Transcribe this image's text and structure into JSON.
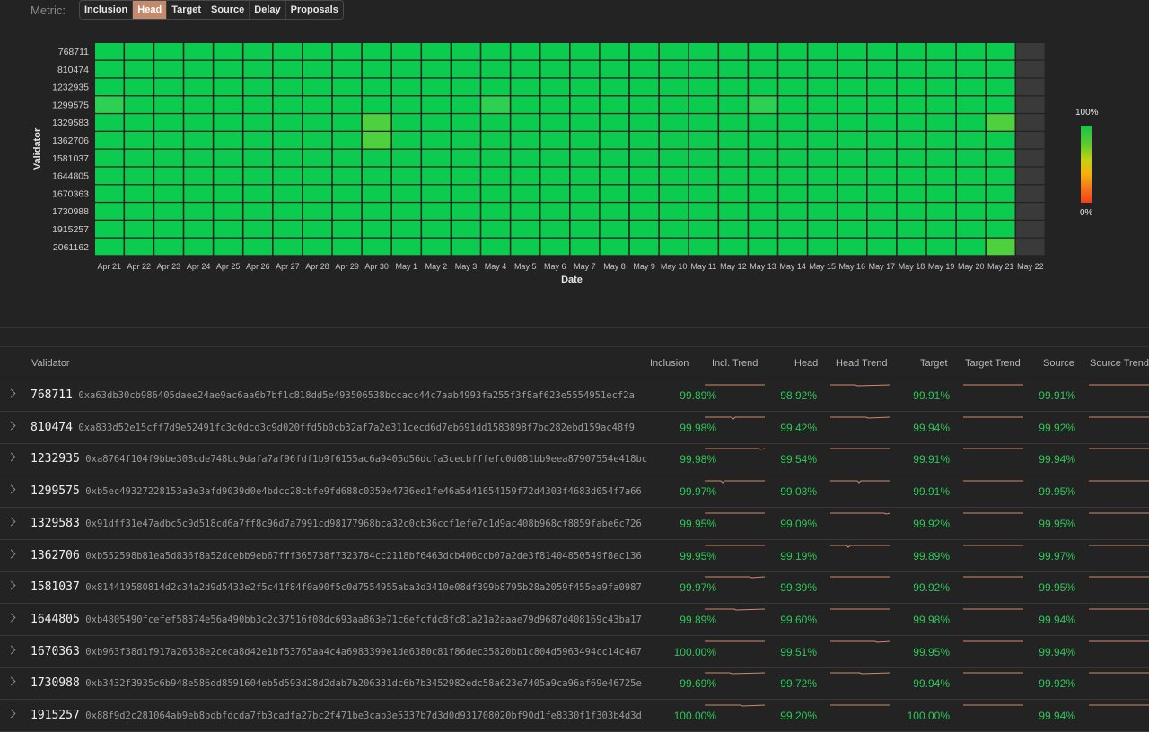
{
  "metric": {
    "label": "Metric:",
    "options": [
      "Inclusion",
      "Head",
      "Target",
      "Source",
      "Delay",
      "Proposals"
    ],
    "active": "Head"
  },
  "heatmap": {
    "ylabel": "Validator",
    "xlabel": "Date",
    "validators": [
      "768711",
      "810474",
      "1232935",
      "1299575",
      "1329583",
      "1362706",
      "1581037",
      "1644805",
      "1670363",
      "1730988",
      "1915257",
      "2061162"
    ],
    "dates": [
      "Apr 21",
      "Apr 22",
      "Apr 23",
      "Apr 24",
      "Apr 25",
      "Apr 26",
      "Apr 27",
      "Apr 28",
      "Apr 29",
      "Apr 30",
      "May 1",
      "May 2",
      "May 3",
      "May 4",
      "May 5",
      "May 6",
      "May 7",
      "May 8",
      "May 9",
      "May 10",
      "May 11",
      "May 12",
      "May 13",
      "May 14",
      "May 15",
      "May 16",
      "May 17",
      "May 18",
      "May 19",
      "May 20",
      "May 21",
      "May 22"
    ],
    "highlights": [
      {
        "validator": "1299575",
        "date": "Apr 21",
        "level": "light"
      },
      {
        "validator": "1299575",
        "date": "May 4",
        "level": "light"
      },
      {
        "validator": "1299575",
        "date": "May 13",
        "level": "light"
      },
      {
        "validator": "1329583",
        "date": "Apr 30",
        "level": "medium"
      },
      {
        "validator": "1329583",
        "date": "May 21",
        "level": "medium"
      },
      {
        "validator": "1362706",
        "date": "Apr 30",
        "level": "medium"
      },
      {
        "validator": "2061162",
        "date": "May 21",
        "level": "medium"
      }
    ],
    "no_data_date": "May 22",
    "legend": {
      "top": "100%",
      "bottom": "0%"
    },
    "colors": {
      "full": "#0ccc4f",
      "light": "#2dd052",
      "medium": "#4fd13f",
      "nodata": "#3a3a3a"
    }
  },
  "table": {
    "headers": [
      "Validator",
      "Inclusion",
      "Incl. Trend",
      "Head",
      "Head Trend",
      "Target",
      "Target Trend",
      "Source",
      "Source Trend"
    ],
    "rows": [
      {
        "id": "768711",
        "address": "0xa63db30cb986405daee24ae9ac6aa6b7bf1c818dd5e493506538bccacc44c7aab4993fa255f3f8af623e5554951ecf2a",
        "inclusion": "99.89%",
        "head": "98.92%",
        "target": "99.91%",
        "source": "99.91%"
      },
      {
        "id": "810474",
        "address": "0xa833d52e15cff7d9e52491fc3c0dcd3c9d020ffd5b0cb32af7a2e311cecd6d7eb691dd1583898f7bd282ebd159ac48f9",
        "inclusion": "99.98%",
        "head": "99.42%",
        "target": "99.94%",
        "source": "99.92%"
      },
      {
        "id": "1232935",
        "address": "0xa8764f104f9bbe308cde748bc9dafa7af96fdf1b9f6155ac6a9405d56dcfa3cecbfffefc0d081bb9eea87907554e418bc",
        "inclusion": "99.98%",
        "head": "99.54%",
        "target": "99.91%",
        "source": "99.94%"
      },
      {
        "id": "1299575",
        "address": "0xb5ec49327228153a3e3afd9039d0e4bdcc28cbfe9fd688c0359e4736ed1fe46a5d41654159f72d4303f4683d054f7a66",
        "inclusion": "99.97%",
        "head": "99.03%",
        "target": "99.91%",
        "source": "99.95%"
      },
      {
        "id": "1329583",
        "address": "0x91dff31e47adbc5c9d518cd6a7ff8c96d7a7991cd98177968bca32c0cb36ccf1efe7d1d9ac408b968cf8859fabe6c726",
        "inclusion": "99.95%",
        "head": "99.09%",
        "target": "99.92%",
        "source": "99.95%"
      },
      {
        "id": "1362706",
        "address": "0xb552598b81ea5d836f8a52dcebb9eb67fff365738f7323784cc2118bf6463dcb406ccb07a2de3f81404850549f8ec136",
        "inclusion": "99.95%",
        "head": "99.19%",
        "target": "99.89%",
        "source": "99.97%"
      },
      {
        "id": "1581037",
        "address": "0x814419580814d2c34a2d9d5433e2f5c41f84f0a90f5c0d7554955aba3d3410e08df399b8795b28a2059f455ea9fa0987",
        "inclusion": "99.97%",
        "head": "99.39%",
        "target": "99.92%",
        "source": "99.95%"
      },
      {
        "id": "1644805",
        "address": "0xb4805490fcefef58374e56a490bb3c2c37516f08dc693aa863e71c6efcfdc8fc81a21a2aaae79d9687d408169c43ba17",
        "inclusion": "99.89%",
        "head": "99.60%",
        "target": "99.98%",
        "source": "99.94%"
      },
      {
        "id": "1670363",
        "address": "0xb963f38d1f917a26538e2ceca8d42e1bf53765aa4c4a6983399e1de6380c81f86dec35820bb1c804d5963494cc14c467",
        "inclusion": "100.00%",
        "head": "99.51%",
        "target": "99.95%",
        "source": "99.94%"
      },
      {
        "id": "1730988",
        "address": "0xb3432f3935c6b948e586dd8591604eb5d593d28d2dab7b206331dc6b7b3452982edc58a623e7405a9ca96af69e46725e",
        "inclusion": "99.69%",
        "head": "99.72%",
        "target": "99.94%",
        "source": "99.92%"
      },
      {
        "id": "1915257",
        "address": "0x88f9d2c281064ab9eb8bdbfdcda7fb3cadfa27bc2f471be3cab3e5337b7d3d0d931708020bf90d1fe8330f1f303b4d3d",
        "inclusion": "100.00%",
        "head": "99.20%",
        "target": "100.00%",
        "source": "99.94%"
      }
    ]
  }
}
